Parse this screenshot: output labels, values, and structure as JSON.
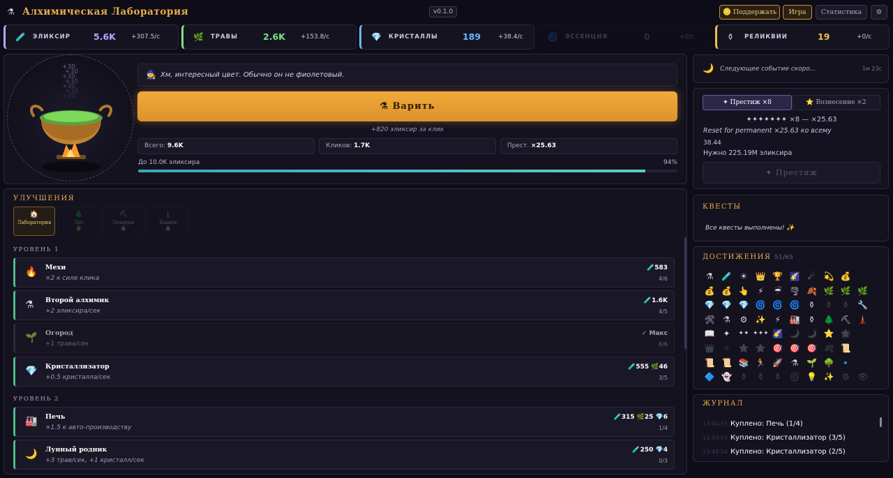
{
  "app": {
    "title": "Алхимическая Лаборатория",
    "version": "v0.1.0"
  },
  "header": {
    "support_label": "Поддержать",
    "game_label": "Игра",
    "stats_label": "Статистика",
    "settings_icon": "⚙"
  },
  "resources": [
    {
      "name": "ЭЛИКСИР",
      "value": "5.6K",
      "rate": "+307.5/с",
      "color": "#b9a3ff",
      "icon": "🧪"
    },
    {
      "name": "ТРАВЫ",
      "value": "2.6K",
      "rate": "+153.8/с",
      "color": "#7fe08a",
      "icon": "🌿"
    },
    {
      "name": "КРИСТАЛЛЫ",
      "value": "189",
      "rate": "+38.4/с",
      "color": "#6ab7ff",
      "icon": "💎"
    },
    {
      "name": "ЭССЕНЦИЯ",
      "value": "0",
      "rate": "+0/с",
      "color": "#8a86a6",
      "icon": "🌀"
    },
    {
      "name": "РЕЛИКВИИ",
      "value": "19",
      "rate": "+0/с",
      "color": "#f0c050",
      "icon": "⚱"
    }
  ],
  "brew": {
    "message": "Хм, интересный цвет. Обычно он не фиолетовый.",
    "message_icon": "🧙",
    "button_label": "⚗ Варить",
    "per_click": "+820 эликсир за клик",
    "floats": [
      "+30",
      "+30",
      "+30",
      "+30",
      "+30",
      "+30",
      "+30"
    ],
    "stats": [
      {
        "label": "Всего:",
        "value": "9.6K"
      },
      {
        "label": "Кликов:",
        "value": "1.7K"
      },
      {
        "label": "Прест.",
        "value": "×25.63"
      }
    ],
    "goal_label": "До 10.0K эликсира",
    "goal_percent": "94%",
    "progress": 0.94
  },
  "upgrades": {
    "title": "УЛУЧШЕНИЯ",
    "tabs": [
      {
        "icon": "🏠",
        "label": "Лаборатория",
        "lock": ""
      },
      {
        "icon": "🌲",
        "label": "Лес",
        "lock": "🔒"
      },
      {
        "icon": "⛏",
        "label": "Пещеры",
        "lock": "🔒"
      },
      {
        "icon": "🗼",
        "label": "Башня",
        "lock": "🔒"
      }
    ],
    "level1_label": "УРОВЕНЬ 1",
    "level2_label": "УРОВЕНЬ 2",
    "level1": [
      {
        "icon": "🔥",
        "name": "Мехи",
        "desc": "×2 к силе клика",
        "cost": "🧪583",
        "count": "4/6"
      },
      {
        "icon": "⚗",
        "name": "Второй алхимик",
        "desc": "+2 эликсира/сек",
        "cost": "🧪1.6K",
        "count": "4/5"
      },
      {
        "icon": "🌱",
        "name": "Огород",
        "desc": "+1 трава/сек",
        "cost": "✓ Макс",
        "count": "6/6"
      },
      {
        "icon": "💎",
        "name": "Кристаллизатор",
        "desc": "+0.5 кристалла/сек",
        "cost": "🧪555 🌿46",
        "count": "3/5"
      }
    ],
    "level2": [
      {
        "icon": "🏭",
        "name": "Печь",
        "desc": "×1.5 к авто-производству",
        "cost": "🧪315 🌿25 💎6",
        "count": "1/4"
      },
      {
        "icon": "🌙",
        "name": "Лунный родник",
        "desc": "+3 трав/сек, +1 кристалл/сек",
        "cost": "🧪250 💎4",
        "count": "0/3"
      }
    ]
  },
  "event": {
    "icon": "🌙",
    "text": "Следующее событие скоро...",
    "time": "1м 23с"
  },
  "prestige": {
    "tab_active": "✦ Престиж ×8",
    "tab_inactive": "⭐ Вознесение ×2",
    "stars": "✦✦✦✦✦✦✦ ×8 — ×25.63",
    "reset_text": "Reset for permanent ×25.63 ко всему",
    "amount": "38.44",
    "need": "Нужно 225.19M эликсира",
    "button_label": "✦ Престиж"
  },
  "quests": {
    "title": "КВЕСТЫ",
    "text": "Все квесты выполнены! ✨"
  },
  "achievements": {
    "title": "ДОСТИЖЕНИЯ",
    "count": "51/65",
    "items": [
      {
        "i": "⚗",
        "u": true
      },
      {
        "i": "🧪",
        "u": true
      },
      {
        "i": "☀",
        "u": true
      },
      {
        "i": "👑",
        "u": true
      },
      {
        "i": "🏆",
        "u": true
      },
      {
        "i": "🌠",
        "u": true
      },
      {
        "i": "☄",
        "u": true
      },
      {
        "i": "💫",
        "u": true
      },
      {
        "i": "💰",
        "u": true
      },
      {
        "i": "",
        "u": false
      },
      {
        "i": "💰",
        "u": true
      },
      {
        "i": "💰",
        "u": true
      },
      {
        "i": "👆",
        "u": true
      },
      {
        "i": "⚡",
        "u": true
      },
      {
        "i": "☔",
        "u": true
      },
      {
        "i": "🌪",
        "u": true
      },
      {
        "i": "🍂",
        "u": true
      },
      {
        "i": "🌿",
        "u": true
      },
      {
        "i": "🌿",
        "u": true
      },
      {
        "i": "🌿",
        "u": true
      },
      {
        "i": "💎",
        "u": true
      },
      {
        "i": "💎",
        "u": true
      },
      {
        "i": "💎",
        "u": true
      },
      {
        "i": "🌀",
        "u": true
      },
      {
        "i": "🌀",
        "u": true
      },
      {
        "i": "🌀",
        "u": true
      },
      {
        "i": "⚱",
        "u": true
      },
      {
        "i": "⚱",
        "u": false
      },
      {
        "i": "⚱",
        "u": false
      },
      {
        "i": "🔧",
        "u": true
      },
      {
        "i": "🛠",
        "u": true
      },
      {
        "i": "⚗",
        "u": true
      },
      {
        "i": "⚙",
        "u": true
      },
      {
        "i": "✨",
        "u": true
      },
      {
        "i": "⚡",
        "u": true
      },
      {
        "i": "🏭",
        "u": true
      },
      {
        "i": "⚱",
        "u": true
      },
      {
        "i": "🌲",
        "u": true
      },
      {
        "i": "⛏",
        "u": true
      },
      {
        "i": "🗼",
        "u": true
      },
      {
        "i": "📖",
        "u": true
      },
      {
        "i": "✦",
        "u": true
      },
      {
        "i": "✦✦",
        "u": true
      },
      {
        "i": "✦✦✦",
        "u": true
      },
      {
        "i": "🌠",
        "u": true
      },
      {
        "i": "🌙",
        "u": false
      },
      {
        "i": "🌙",
        "u": false
      },
      {
        "i": "⭐",
        "u": true
      },
      {
        "i": "🌟",
        "u": false
      },
      {
        "i": "",
        "u": false
      },
      {
        "i": "👑",
        "u": false
      },
      {
        "i": "✧",
        "u": false
      },
      {
        "i": "⭐",
        "u": false
      },
      {
        "i": "⭐",
        "u": false
      },
      {
        "i": "🎯",
        "u": true
      },
      {
        "i": "🎯",
        "u": true
      },
      {
        "i": "🎯",
        "u": true
      },
      {
        "i": "🍂",
        "u": false
      },
      {
        "i": "📜",
        "u": true
      },
      {
        "i": "",
        "u": false
      },
      {
        "i": "📜",
        "u": true
      },
      {
        "i": "📜",
        "u": true
      },
      {
        "i": "📚",
        "u": true
      },
      {
        "i": "🏃",
        "u": true
      },
      {
        "i": "🚀",
        "u": true
      },
      {
        "i": "⚗",
        "u": true
      },
      {
        "i": "🌱",
        "u": true
      },
      {
        "i": "🌳",
        "u": true
      },
      {
        "i": "🔹",
        "u": true
      },
      {
        "i": "",
        "u": false
      },
      {
        "i": "🔷",
        "u": true
      },
      {
        "i": "👻",
        "u": true
      },
      {
        "i": "⚱",
        "u": false
      },
      {
        "i": "⚱",
        "u": false
      },
      {
        "i": "⚱",
        "u": false
      },
      {
        "i": "🌀",
        "u": false
      },
      {
        "i": "💡",
        "u": true
      },
      {
        "i": "✨",
        "u": true
      },
      {
        "i": "⚙",
        "u": false
      },
      {
        "i": "👁",
        "u": false
      }
    ]
  },
  "journal": {
    "title": "ЖУРНАЛ",
    "entries": [
      {
        "time": "13:44:55",
        "text": "Куплено: Печь (1/4)"
      },
      {
        "time": "13:44:54",
        "text": "Куплено: Кристаллизатор (3/5)"
      },
      {
        "time": "13:44:54",
        "text": "Куплено: Кристаллизатор (2/5)"
      }
    ]
  },
  "colors": {
    "accent": "#e8b04a",
    "brew_button": "#e8a232",
    "progress": "#4fc3c0",
    "upgrade_border": "#4fb98c"
  }
}
